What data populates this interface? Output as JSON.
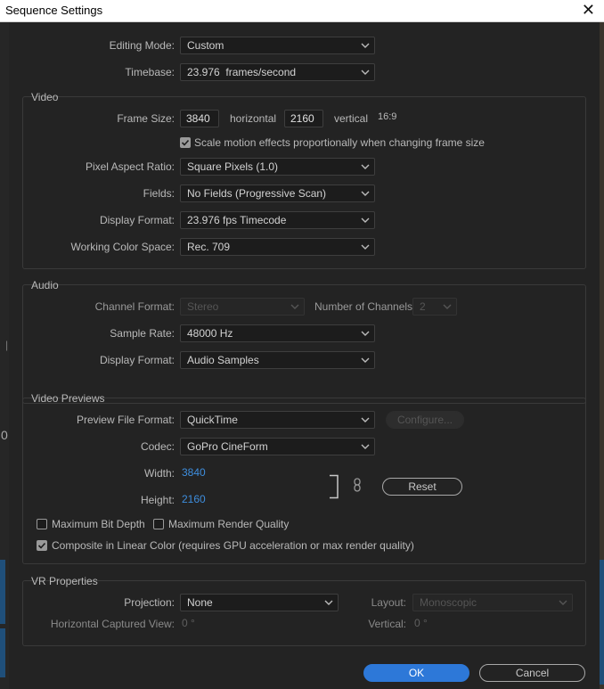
{
  "window": {
    "title": "Sequence Settings",
    "close_glyph": "✕"
  },
  "top": {
    "editing_mode_label": "Editing Mode:",
    "editing_mode_value": "Custom",
    "timebase_label": "Timebase:",
    "timebase_value": "23.976  frames/second"
  },
  "video": {
    "title": "Video",
    "frame_size_label": "Frame Size:",
    "frame_width": "3840",
    "horizontal_label": "horizontal",
    "frame_height": "2160",
    "vertical_label": "vertical",
    "aspect": "16:9",
    "scale_motion_label": "Scale motion effects proportionally when changing frame size",
    "scale_motion_checked": true,
    "pixel_aspect_label": "Pixel Aspect Ratio:",
    "pixel_aspect_value": "Square Pixels (1.0)",
    "fields_label": "Fields:",
    "fields_value": "No Fields (Progressive Scan)",
    "display_format_label": "Display Format:",
    "display_format_value": "23.976 fps Timecode",
    "color_space_label": "Working Color Space:",
    "color_space_value": "Rec. 709"
  },
  "audio": {
    "title": "Audio",
    "channel_format_label": "Channel Format:",
    "channel_format_value": "Stereo",
    "num_channels_label": "Number of Channels:",
    "num_channels_value": "2",
    "sample_rate_label": "Sample Rate:",
    "sample_rate_value": "48000 Hz",
    "display_format_label": "Display Format:",
    "display_format_value": "Audio Samples"
  },
  "previews": {
    "title": "Video Previews",
    "file_format_label": "Preview File Format:",
    "file_format_value": "QuickTime",
    "configure_label": "Configure...",
    "codec_label": "Codec:",
    "codec_value": "GoPro CineForm",
    "width_label": "Width:",
    "width_value": "3840",
    "height_label": "Height:",
    "height_value": "2160",
    "reset_label": "Reset",
    "max_bit_depth_label": "Maximum Bit Depth",
    "max_bit_depth_checked": false,
    "max_render_quality_label": "Maximum Render Quality",
    "max_render_quality_checked": false,
    "linear_color_label": "Composite in Linear Color (requires GPU acceleration or max render quality)",
    "linear_color_checked": true
  },
  "vr": {
    "title": "VR Properties",
    "projection_label": "Projection:",
    "projection_value": "None",
    "layout_label": "Layout:",
    "layout_value": "Monoscopic",
    "h_view_label": "Horizontal Captured View:",
    "h_view_value": "0 °",
    "vertical_label": "Vertical:",
    "vertical_value": "0 °"
  },
  "footer": {
    "ok_label": "OK",
    "cancel_label": "Cancel"
  },
  "background": {
    "fragment_text_1": "|",
    "fragment_text_2": "0"
  },
  "colors": {
    "accent": "#2d78d8",
    "link": "#3e8ede",
    "panel": "#232323"
  }
}
